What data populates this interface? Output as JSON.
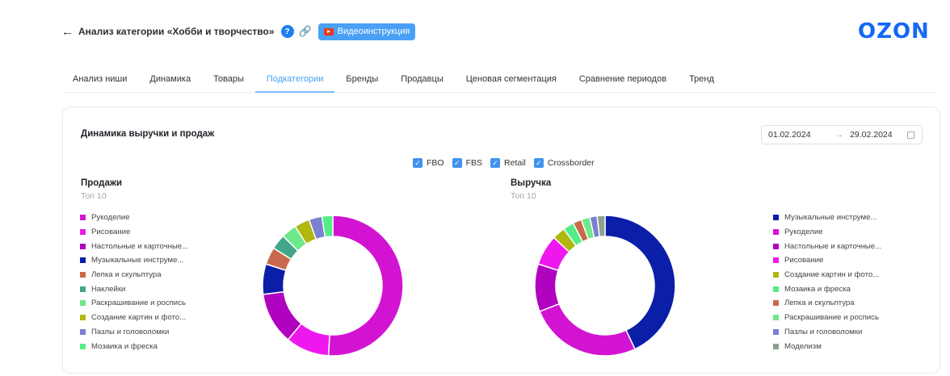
{
  "header": {
    "back_icon": "arrow-left-icon",
    "title": "Анализ категории «Хобби и творчество»",
    "help_icon": "question-icon",
    "link_icon": "link-icon",
    "video_label": "Видеоинструкция",
    "logo": "OZON"
  },
  "tabs": [
    "Анализ ниши",
    "Динамика",
    "Товары",
    "Подкатегории",
    "Бренды",
    "Продавцы",
    "Ценовая сегментация",
    "Сравнение периодов",
    "Тренд"
  ],
  "active_tab": "Подкатегории",
  "card": {
    "title": "Динамика выручки и продаж",
    "date_from": "01.02.2024",
    "date_to": "29.02.2024",
    "arrow": "→",
    "filters": [
      "FBO",
      "FBS",
      "Retail",
      "Crossborder"
    ]
  },
  "chart_data": [
    {
      "type": "pie",
      "title": "Продажи",
      "subtitle": "Топ 10",
      "legend": "left",
      "categories": [
        "Рукоделие",
        "Рисование",
        "Настольные и карточные...",
        "Музыкальные инструме...",
        "Лепка и скульптура",
        "Наклейки",
        "Раскрашивание и роспись",
        "Создание картин и фото...",
        "Пазлы и головоломки",
        "Мозаика и фреска"
      ],
      "values": [
        51,
        10,
        12,
        7,
        4,
        3.5,
        3.5,
        3.5,
        3,
        2.5
      ],
      "colors": [
        "#d214d2",
        "#ee18ee",
        "#b000c0",
        "#0a1ea8",
        "#c9694b",
        "#45a58a",
        "#6ee88a",
        "#b0b810",
        "#7b80d0",
        "#55ec88"
      ]
    },
    {
      "type": "pie",
      "title": "Выручка",
      "subtitle": "Топ 10",
      "legend": "right",
      "categories": [
        "Музыкальные инструме...",
        "Рукоделие",
        "Настольные и карточные...",
        "Рисование",
        "Создание картин и фото...",
        "Мозаика и фреска",
        "Лепка и скульптура",
        "Раскрашивание и роспись",
        "Пазлы и головоломки",
        "Моделизм"
      ],
      "values": [
        43,
        26,
        11,
        7,
        3,
        2.5,
        2,
        2,
        1.7,
        1.8
      ],
      "colors": [
        "#0a1ea8",
        "#d214d2",
        "#b000c0",
        "#ee18ee",
        "#b0b810",
        "#55ec88",
        "#c9694b",
        "#6ee88a",
        "#7b80d0",
        "#8fa090"
      ]
    }
  ]
}
